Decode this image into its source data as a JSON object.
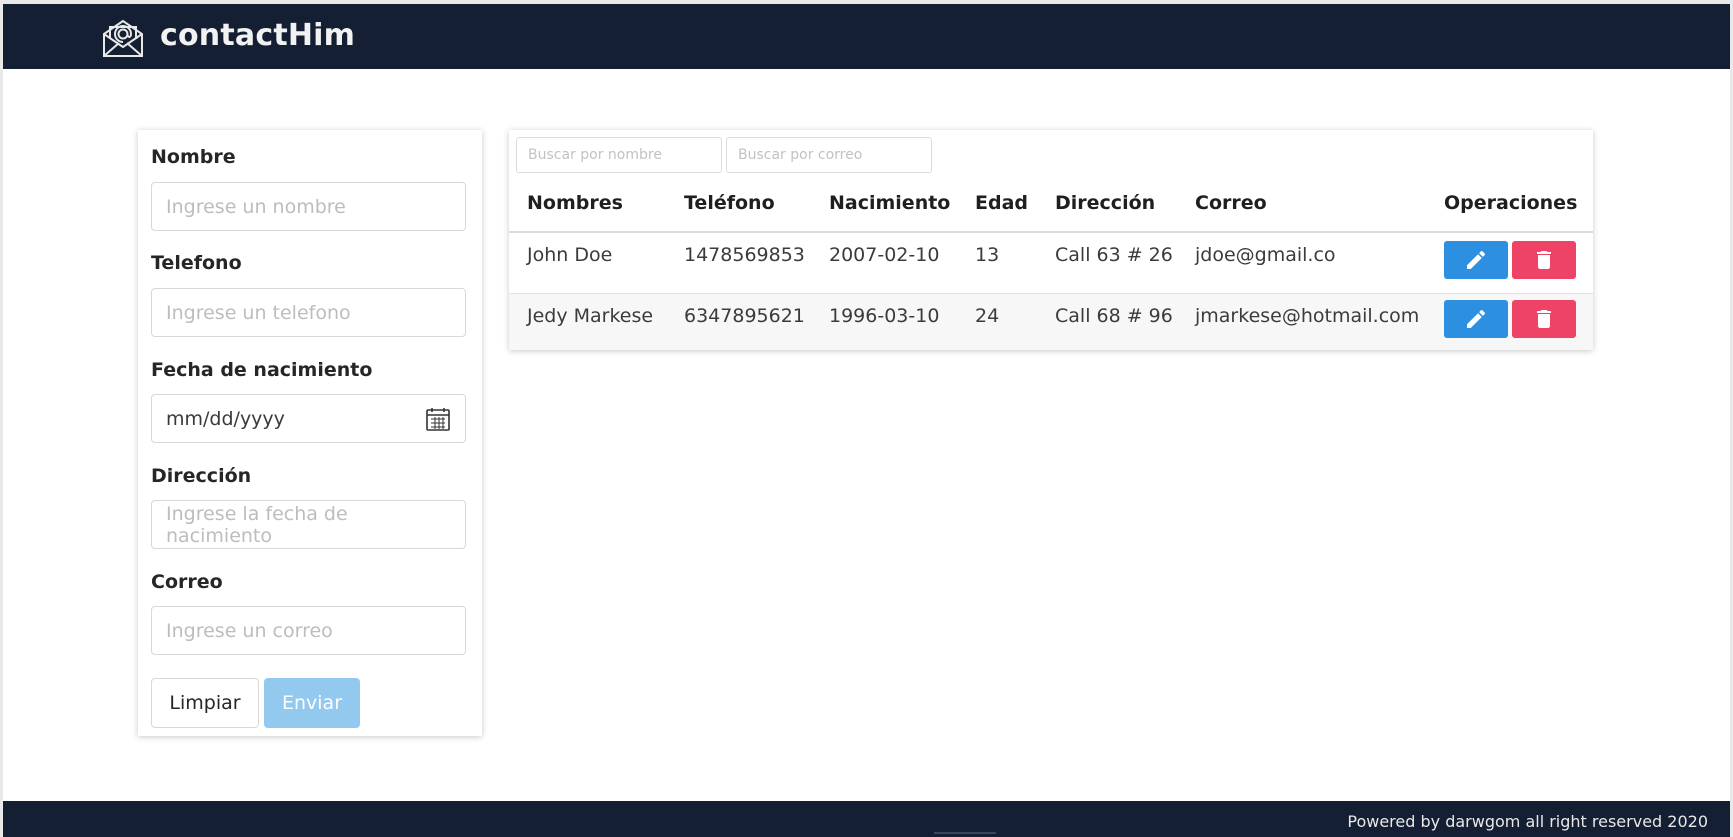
{
  "brand": {
    "title": "contactHim"
  },
  "form": {
    "fields": [
      {
        "label": "Nombre",
        "placeholder": "Ingrese un nombre"
      },
      {
        "label": "Telefono",
        "placeholder": "Ingrese un telefono"
      },
      {
        "label": "Fecha de nacimiento",
        "value": "mm/dd/yyyy"
      },
      {
        "label": "Dirección",
        "placeholder": "Ingrese la fecha de nacimiento"
      },
      {
        "label": "Correo",
        "placeholder": "Ingrese un correo"
      }
    ],
    "clear_label": "Limpiar",
    "send_label": "Enviar"
  },
  "search": {
    "by_name_placeholder": "Buscar por nombre",
    "by_email_placeholder": "Buscar por correo"
  },
  "table": {
    "headers": [
      "Nombres",
      "Teléfono",
      "Nacimiento",
      "Edad",
      "Dirección",
      "Correo",
      "Operaciones"
    ],
    "rows": [
      [
        "John Doe",
        "1478569853",
        "2007-02-10",
        "13",
        "Call 63 # 26",
        "jdoe@gmail.co"
      ],
      [
        "Jedy Markese",
        "6347895621",
        "1996-03-10",
        "24",
        "Call 68 # 96",
        "jmarkese@hotmail.com"
      ]
    ]
  },
  "footer": {
    "text": "Powered by darwgom all right reserved 2020"
  },
  "colors": {
    "navbar": "#141f33",
    "edit_button": "#2c8fe0",
    "delete_button": "#ee4366",
    "send_button_disabled": "#93c9ee"
  },
  "icons": {
    "brand": "envelope-icon",
    "date": "calendar-icon",
    "edit": "pencil-icon",
    "delete": "trash-icon"
  }
}
